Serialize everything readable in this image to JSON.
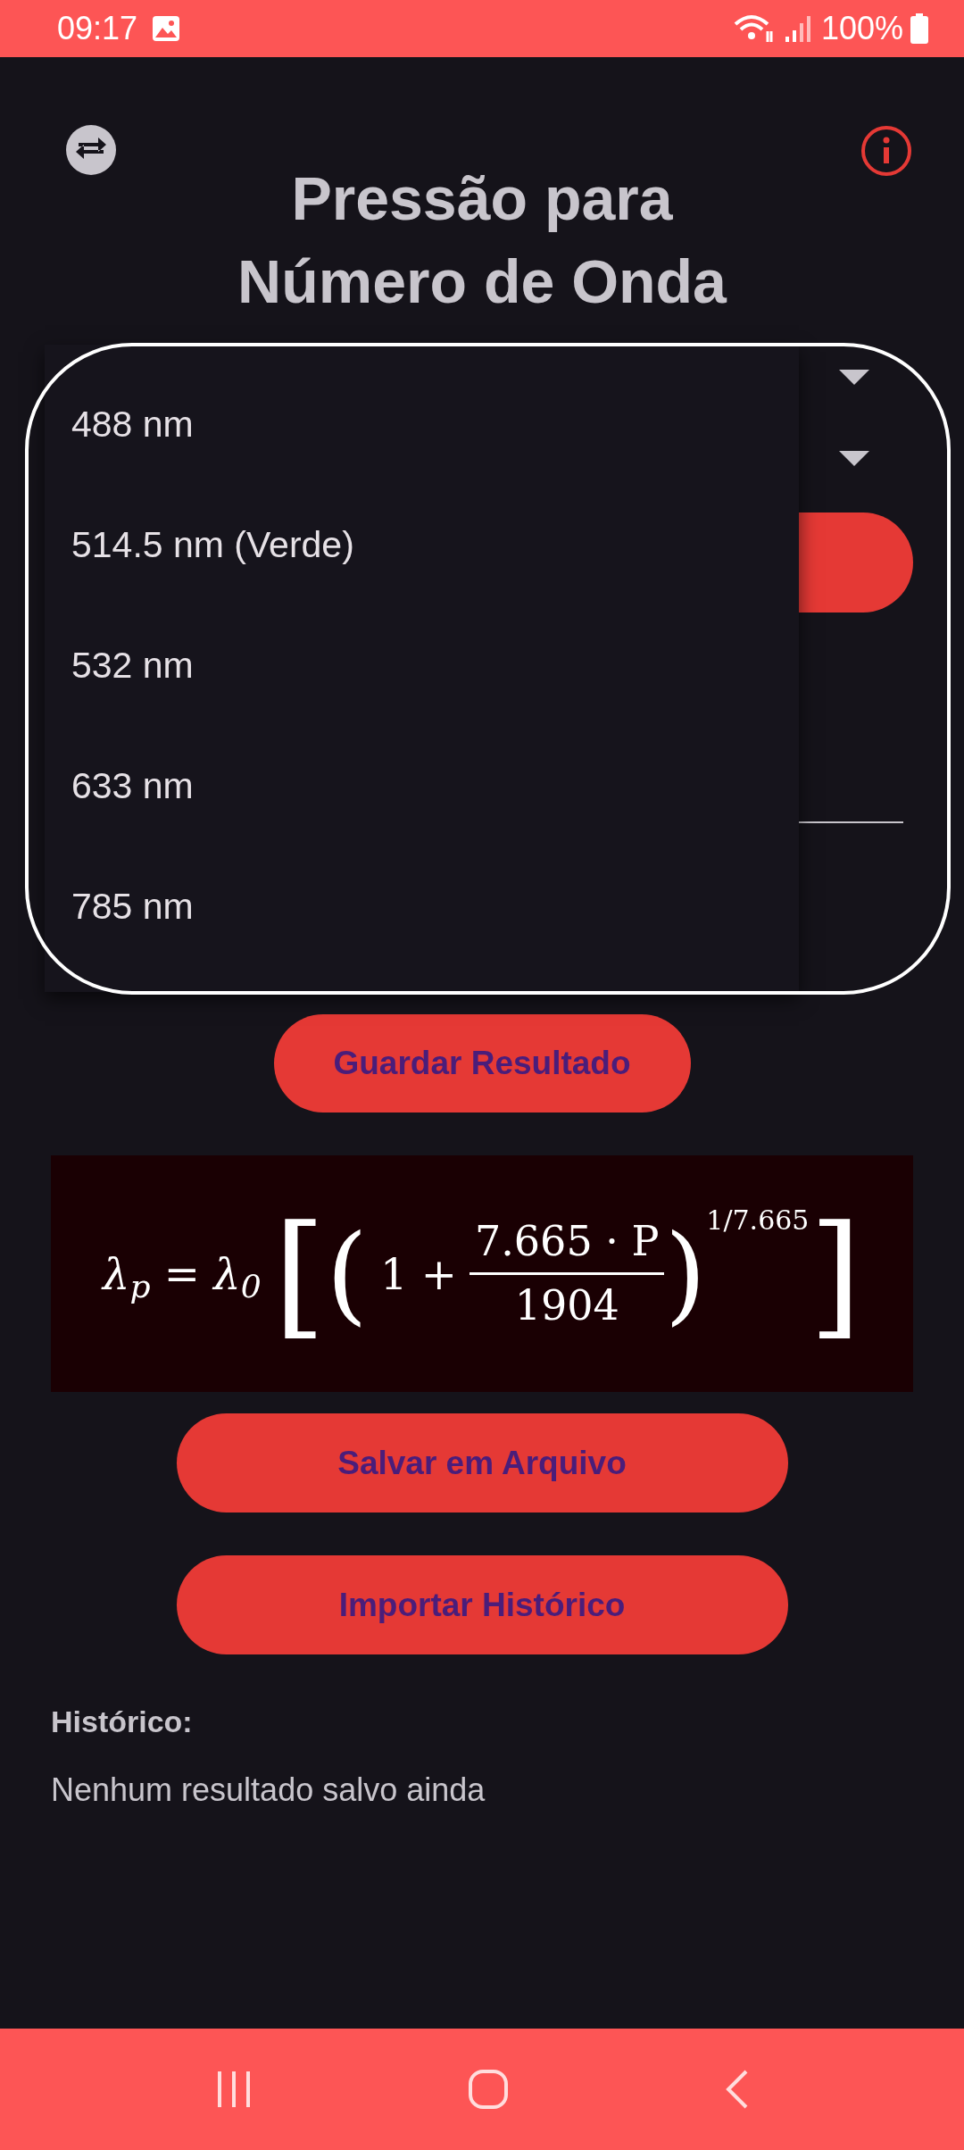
{
  "status_bar": {
    "time": "09:17",
    "battery": "100%"
  },
  "header": {
    "title_lines": [
      "Pressão para",
      "Número de Onda"
    ]
  },
  "dropdown_menu": {
    "options": [
      {
        "label": "488 nm"
      },
      {
        "label": "514.5 nm (Verde)"
      },
      {
        "label": "532 nm"
      },
      {
        "label": "633 nm"
      },
      {
        "label": "785 nm"
      }
    ]
  },
  "save_result_button": "Guardar Resultado",
  "formula": {
    "lhs": "λ$_{p}$ = λ$_{0}$",
    "open_bracket": "[",
    "open_paren": "(",
    "term": "1 +",
    "numerator": "7.665 · P",
    "denominator": "1904",
    "close_paren": ")",
    "exponent": "1/7.665",
    "close_bracket": "]"
  },
  "file_buttons": [
    "Salvar em Arquivo",
    "Importar Histórico"
  ],
  "history": {
    "heading": "Histórico:",
    "empty_text": "Nenhum resultado salvo ainda"
  }
}
